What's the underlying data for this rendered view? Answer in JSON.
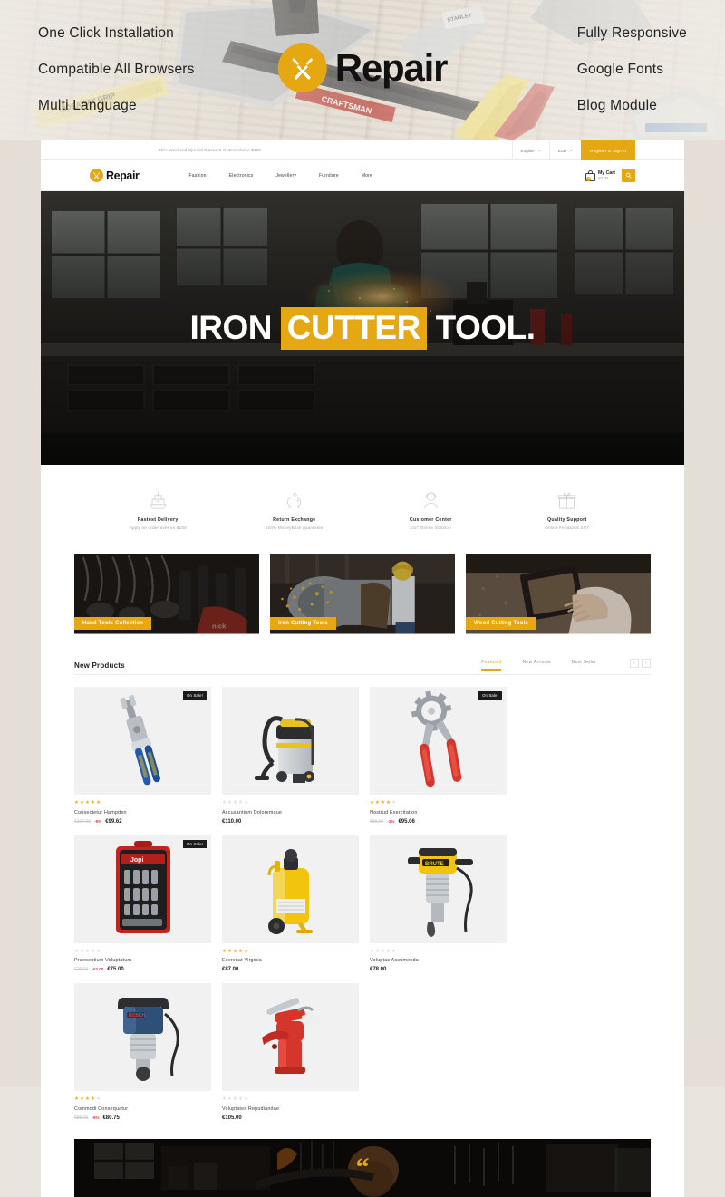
{
  "promo": {
    "left_features": [
      "One Click Installation",
      "Compatible All Browsers",
      "Multi Language"
    ],
    "right_features": [
      "Fully Responsive",
      "Google Fonts",
      "Blog Module"
    ],
    "logo_text": "Repair",
    "logo_icon": "crossed-tools-icon",
    "accent_color": "#e5a812"
  },
  "site": {
    "topbar": {
      "note": "30% Weekend Special Discount Orders Above $100",
      "language": "English",
      "currency": "EUR",
      "auth_label": "Register or Sign in"
    },
    "header": {
      "logo_text": "Repair",
      "logo_icon": "crossed-tools-icon",
      "nav": [
        "Fashion",
        "Electronics",
        "Jewellery",
        "Furniture",
        "More"
      ],
      "cart_label": "My Cart",
      "cart_amount": "€0.00",
      "cart_count": "0",
      "search_icon": "magnifier-icon"
    },
    "hero": {
      "title_part1": "IRON ",
      "title_highlight": "CUTTER",
      "title_part2": " TOOL."
    },
    "services": [
      {
        "icon": "ship-icon",
        "title": "Fastest Delivery",
        "sub": "Apply on order over on $159"
      },
      {
        "icon": "piggy-bank-icon",
        "title": "Return Exchange",
        "sub": "100% MoneyBack guarantee"
      },
      {
        "icon": "support-agent-icon",
        "title": "Customer Center",
        "sub": "24/7 Online Solution"
      },
      {
        "icon": "gift-icon",
        "title": "Quality Support",
        "sub": "Online Feedback 24/7"
      }
    ],
    "categories": [
      {
        "label": "Hand Tools Collection"
      },
      {
        "label": "Iron Cutting Tools"
      },
      {
        "label": "Wood Cutting Tools"
      }
    ],
    "new_products": {
      "title": "New Products",
      "tabs": [
        {
          "label": "Featured",
          "active": true
        },
        {
          "label": "New Arrivals",
          "active": false
        },
        {
          "label": "Best Seller",
          "active": false
        }
      ],
      "prev_arrow": "‹",
      "next_arrow": "›",
      "badge_label": "On Sale!",
      "products": [
        {
          "name": "Consectetur Hampden",
          "rating": 5,
          "old_price": "€104.00",
          "discount": "-5%",
          "price": "€99.62",
          "on_sale": true,
          "image": "wire-stripper-pliers"
        },
        {
          "name": "Accusantium Doloremque",
          "rating": 0,
          "old_price": "",
          "discount": "",
          "price": "€110.00",
          "on_sale": false,
          "image": "wet-dry-vacuum"
        },
        {
          "name": "Nostrud Exercitation",
          "rating": 4,
          "old_price": "€98.00",
          "discount": "-3%",
          "price": "€95.06",
          "on_sale": true,
          "image": "red-handle-punch-pliers"
        },
        {
          "name": "Praesentium Voluptatum",
          "rating": 0,
          "old_price": "€79.00",
          "discount": "-€4.00",
          "price": "€75.00",
          "on_sale": true,
          "image": "socket-tool-set-case"
        },
        {
          "name": "Exercitat Virginia",
          "rating": 5,
          "old_price": "",
          "discount": "",
          "price": "€87.00",
          "on_sale": false,
          "image": "yellow-air-compressor"
        },
        {
          "name": "Voluptas Assumenda",
          "rating": 0,
          "old_price": "",
          "discount": "",
          "price": "€78.00",
          "on_sale": false,
          "image": "yellow-demolition-hammer"
        },
        {
          "name": "Commodi Consequatur",
          "rating": 4,
          "old_price": "€85.00",
          "discount": "-5%",
          "price": "€80.75",
          "on_sale": false,
          "image": "blue-demolition-hammer"
        },
        {
          "name": "Voluptates Repudiandae",
          "rating": 0,
          "old_price": "",
          "discount": "",
          "price": "€105.00",
          "on_sale": false,
          "image": "red-rivet-gun"
        }
      ]
    },
    "testimonial": {
      "quote_mark": "“"
    }
  }
}
